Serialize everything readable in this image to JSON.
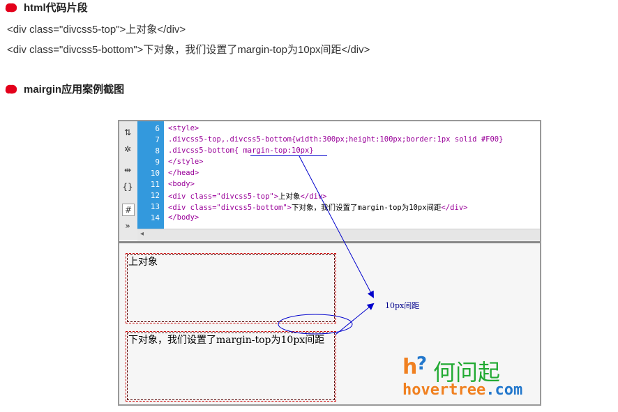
{
  "section1": {
    "title": "html代码片段"
  },
  "code_lines": [
    "<div class=\"divcss5-top\">上对象</div>",
    "<div class=\"divcss5-bottom\">下对象，我们设置了margin-top为10px间距</div>"
  ],
  "section2": {
    "title": "mairgin应用案例截图"
  },
  "editor": {
    "line_numbers": [
      "6",
      "7",
      "8",
      "9",
      "10",
      "11",
      "12",
      "13",
      "14"
    ],
    "lines": [
      {
        "tag": "<style>",
        "text": ""
      },
      {
        "tag": ".divcss5-top,.divcss5-bottom{width:300px;height:100px;border:1px solid #F00}",
        "text": ""
      },
      {
        "tag": ".divcss5-bottom{ margin-top:10px}",
        "text": ""
      },
      {
        "tag": "</style>",
        "text": ""
      },
      {
        "tag": "</head>",
        "text": ""
      },
      {
        "tag": "<body>",
        "text": ""
      },
      {
        "tag": "<div class=\"divcss5-top\">",
        "text": "上对象",
        "close": "</div>"
      },
      {
        "tag": "<div class=\"divcss5-bottom\">",
        "text": "下对象，我们设置了margin-top为10px间距",
        "close": "</div>"
      },
      {
        "tag": "</body>",
        "text": ""
      }
    ]
  },
  "preview": {
    "top_box": "上对象",
    "bottom_box": "下对象，我们设置了margin-top为10px间距",
    "annotation": "10px间距"
  },
  "watermark": {
    "cn": "何问起",
    "en": "hovertree",
    "dot": ".com"
  },
  "colors": {
    "brand_green": "#22aa33",
    "brand_orange": "#f08020",
    "brand_blue": "#2277cc",
    "gutter": "#3399dd",
    "arrow": "#0000cc"
  }
}
